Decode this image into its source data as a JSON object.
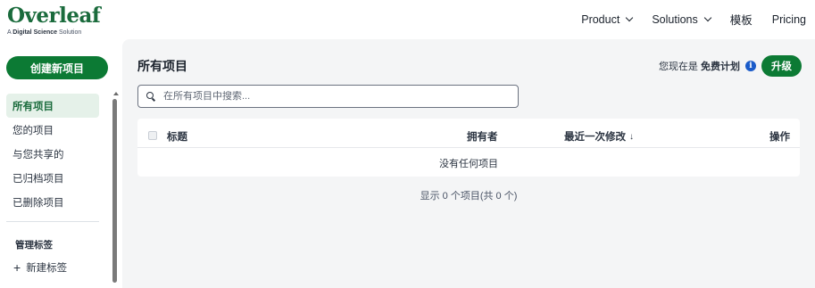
{
  "brand": {
    "name": "Overleaf",
    "subtitle_prefix": "A ",
    "subtitle_bold": "Digital Science",
    "subtitle_suffix": " Solution"
  },
  "nav": {
    "product": "Product",
    "solutions": "Solutions",
    "templates": "模板",
    "pricing": "Pricing"
  },
  "sidebar": {
    "new_project": "创建新项目",
    "items": [
      {
        "label": "所有项目",
        "active": true
      },
      {
        "label": "您的项目"
      },
      {
        "label": "与您共享的"
      },
      {
        "label": "已归档项目"
      },
      {
        "label": "已删除项目"
      }
    ],
    "tags_header": "管理标签",
    "new_tag": "新建标签"
  },
  "main": {
    "title": "所有项目",
    "plan_prefix": "您现在是",
    "plan_name": "免费计划",
    "upgrade": "升级",
    "search_placeholder": "在所有项目中搜索...",
    "table": {
      "col_title": "标题",
      "col_owner": "拥有者",
      "col_modified": "最近一次修改",
      "sort_arrow": "↓",
      "col_actions": "操作",
      "empty": "没有任何项目"
    },
    "showing": "显示 0 个项目(共 0 个)"
  },
  "colors": {
    "brand_green": "#0c7a34",
    "info_blue": "#1a5bc9",
    "active_bg": "#e5f1e9"
  }
}
